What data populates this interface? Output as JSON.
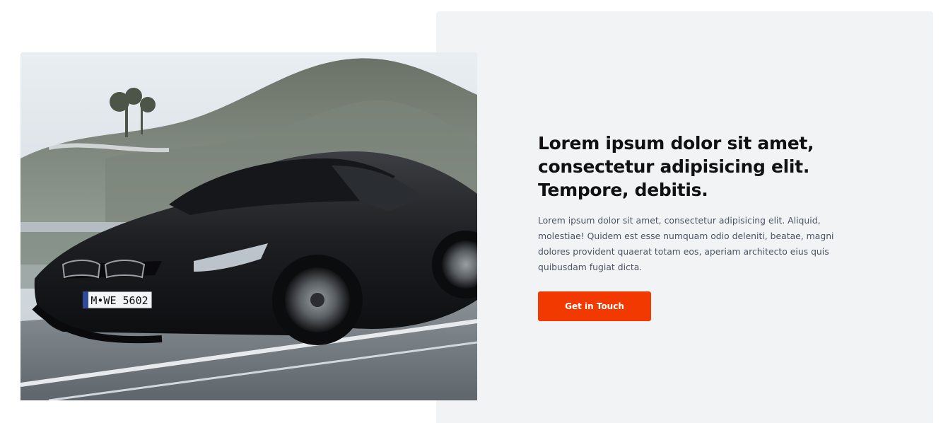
{
  "feature": {
    "headline": "Lorem ipsum dolor sit amet, consectetur adipisicing elit. Tempore, debitis.",
    "description": "Lorem ipsum dolor sit amet, consectetur adipisicing elit. Aliquid, molestiae! Quidem est esse numquam odio deleniti, beatae, magni dolores provident quaerat totam eos, aperiam architecto eius quis quibusdam fugiat dicta.",
    "cta_label": "Get in Touch"
  },
  "image": {
    "license_plate": "M•WE 5602"
  },
  "colors": {
    "accent": "#f23a00",
    "panel_background": "#f2f3f5",
    "heading": "#111111",
    "body_text": "#4b5563"
  }
}
